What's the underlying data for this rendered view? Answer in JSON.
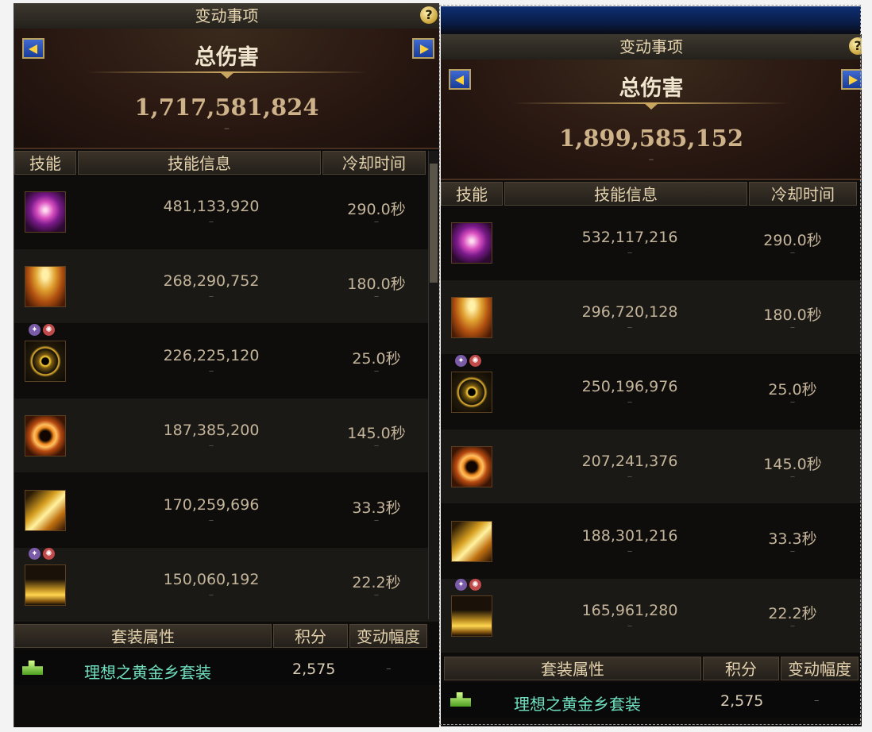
{
  "panels": [
    {
      "title": "变动事项",
      "help": "?",
      "header_label": "总伤害",
      "total_damage": "1,717,581,824",
      "total_change": "–",
      "columns": {
        "skill": "技能",
        "info": "技能信息",
        "cooldown": "冷却时间"
      },
      "skills": [
        {
          "icon": "dark-vortex-icon",
          "damage": "481,133,920",
          "cooldown": "290.0秒",
          "change": "–"
        },
        {
          "icon": "golden-sun-icon",
          "damage": "268,290,752",
          "cooldown": "180.0秒",
          "change": "–"
        },
        {
          "icon": "golden-orbit-icon",
          "damage": "226,225,120",
          "cooldown": "25.0秒",
          "change": "–"
        },
        {
          "icon": "flame-ring-icon",
          "damage": "187,385,200",
          "cooldown": "145.0秒",
          "change": "–"
        },
        {
          "icon": "golden-burst-icon",
          "damage": "170,259,696",
          "cooldown": "33.3秒",
          "change": "–"
        },
        {
          "icon": "golden-crown-icon",
          "damage": "150,060,192",
          "cooldown": "22.2秒",
          "change": "–"
        }
      ],
      "set_columns": {
        "name": "套装属性",
        "score": "积分",
        "change": "变动幅度"
      },
      "set": {
        "name": "理想之黄金乡套装",
        "score": "2,575",
        "change": "–"
      }
    },
    {
      "title": "变动事项",
      "help": "?",
      "header_label": "总伤害",
      "total_damage": "1,899,585,152",
      "total_change": "–",
      "columns": {
        "skill": "技能",
        "info": "技能信息",
        "cooldown": "冷却时间"
      },
      "skills": [
        {
          "icon": "dark-vortex-icon",
          "damage": "532,117,216",
          "cooldown": "290.0秒",
          "change": "–"
        },
        {
          "icon": "golden-sun-icon",
          "damage": "296,720,128",
          "cooldown": "180.0秒",
          "change": "–"
        },
        {
          "icon": "golden-orbit-icon",
          "damage": "250,196,976",
          "cooldown": "25.0秒",
          "change": "–"
        },
        {
          "icon": "flame-ring-icon",
          "damage": "207,241,376",
          "cooldown": "145.0秒",
          "change": "–"
        },
        {
          "icon": "golden-burst-icon",
          "damage": "188,301,216",
          "cooldown": "33.3秒",
          "change": "–"
        },
        {
          "icon": "golden-crown-icon",
          "damage": "165,961,280",
          "cooldown": "22.2秒",
          "change": "–"
        }
      ],
      "set_columns": {
        "name": "套装属性",
        "score": "积分",
        "change": "变动幅度"
      },
      "set": {
        "name": "理想之黄金乡套装",
        "score": "2,575",
        "change": "–"
      }
    }
  ],
  "badges": {
    "rune": "✦",
    "swirl": "✺"
  }
}
